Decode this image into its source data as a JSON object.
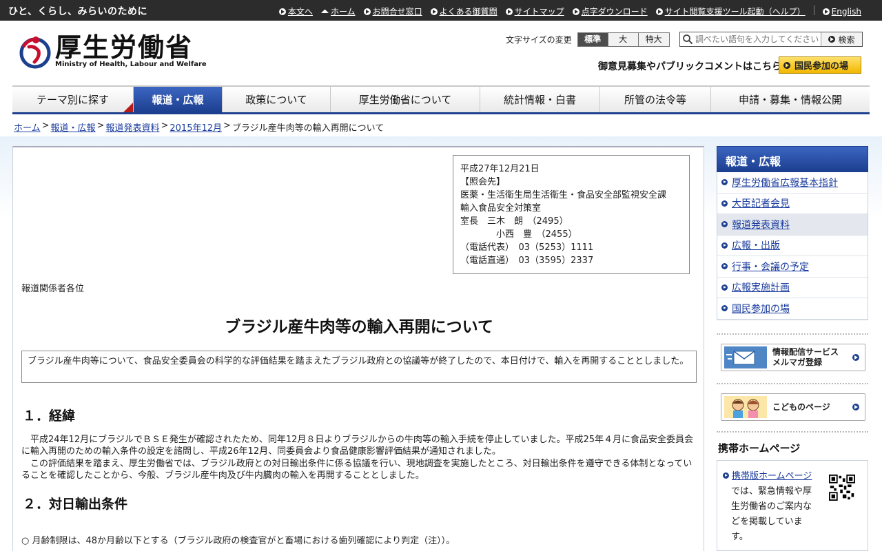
{
  "topbar": {
    "tagline": "ひと、くらし、みらいのために",
    "links": [
      {
        "label": "本文へ",
        "icon": "arrow-circle-icon"
      },
      {
        "label": "ホーム",
        "icon": "home-icon"
      },
      {
        "label": "お問合せ窓口",
        "icon": "arrow-circle-icon"
      },
      {
        "label": "よくある御質問",
        "icon": "arrow-circle-icon"
      },
      {
        "label": "サイトマップ",
        "icon": "arrow-circle-icon"
      },
      {
        "label": "点字ダウンロード",
        "icon": "arrow-circle-icon"
      },
      {
        "label": "サイト閲覧支援ツール起動（ヘルプ）",
        "icon": "arrow-circle-icon"
      },
      {
        "label": "English",
        "icon": "arrow-circle-icon"
      }
    ]
  },
  "header": {
    "logo_jp": "厚生労働省",
    "logo_en": "Ministry of Health, Labour and Welfare",
    "fontsize_label": "文字サイズの変更",
    "fontsize_options": [
      "標準",
      "大",
      "特大"
    ],
    "search_placeholder": "調べたい語句を入力してください",
    "search_button": "検索",
    "pubcom": "御意見募集やパブリックコメントはこちら",
    "sanka_button": "国民参加の場"
  },
  "gnav": [
    {
      "label": "テーマ別に探す",
      "active": false
    },
    {
      "label": "報道・広報",
      "active": true
    },
    {
      "label": "政策について",
      "active": false
    },
    {
      "label": "厚生労働省について",
      "active": false
    },
    {
      "label": "統計情報・白書",
      "active": false
    },
    {
      "label": "所管の法令等",
      "active": false
    },
    {
      "label": "申請・募集・情報公開",
      "active": false
    }
  ],
  "breadcrumb": {
    "items": [
      "ホーム",
      "報道・広報",
      "報道発表資料",
      "2015年12月"
    ],
    "current": "ブラジル産牛肉等の輸入再開について"
  },
  "infobox": {
    "lines": [
      "平成27年12月21日",
      "【照会先】",
      "医薬・生活衛生局生活衛生・食品安全部監視安全課",
      "輸入食品安全対策室",
      "室長　三木　朗　（2495）",
      "　　　　小西　豊　（2455）",
      "（電話代表）　03（5253）1111",
      "（電話直通）　03（3595）2337"
    ]
  },
  "article": {
    "addressee": "報道関係者各位",
    "title": "ブラジル産牛肉等の輸入再開について",
    "summary": "ブラジル産牛肉等について、食品安全委員会の科学的な評価結果を踏まえたブラジル政府との協議等が終了したので、本日付けで、輸入を再開することとしました。",
    "section1_heading": "１．経緯",
    "section1_p1": "　平成24年12月にブラジルでＢＳＥ発生が確認されたため、同年12月８日よりブラジルからの牛肉等の輸入手続を停止していました。平成25年４月に食品安全委員会に輸入再開のための輸入条件の設定を諮問し、平成26年12月、同委員会より食品健康影響評価結果が通知されました。",
    "section1_p2": "　この評価結果を踏まえ、厚生労働省では、ブラジル政府との対日輸出条件に係る協議を行い、現地調査を実施したところ、対日輸出条件を遵守できる体制となっていることを確認したことから、今般、ブラジル産牛肉及び牛内臓肉の輸入を再開することとしました。",
    "section2_heading": "２．対日輸出条件",
    "section2_item1": "○ 月齢制限は、48か月齢以下とする（ブラジル政府の検査官がと畜場における歯列確認により判定（注））。"
  },
  "sidebar": {
    "heading": "報道・広報",
    "items": [
      {
        "label": "厚生労働省広報基本指針",
        "current": false
      },
      {
        "label": "大臣記者会見",
        "current": false
      },
      {
        "label": "報道発表資料",
        "current": true
      },
      {
        "label": "広報・出版",
        "current": false
      },
      {
        "label": "行事・会議の予定",
        "current": false
      },
      {
        "label": "広報実施計画",
        "current": false
      },
      {
        "label": "国民参加の場",
        "current": false
      }
    ],
    "banner_mail_line1": "情報配信サービス",
    "banner_mail_line2": "メルマガ登録",
    "banner_kids": "こどものページ",
    "mobile_heading": "携帯ホームページ",
    "mobile_link": "携帯版ホームページ",
    "mobile_text": "では、緊急情報や厚生労働省のご案内などを掲載しています。"
  },
  "colors": {
    "topbar": "#2c2c2c",
    "nav_active": "#1c3f8f",
    "link": "#1a3c9e",
    "sanka": "#f3b800",
    "logo_red": "#c8102e",
    "logo_blue": "#1c3f8f"
  }
}
